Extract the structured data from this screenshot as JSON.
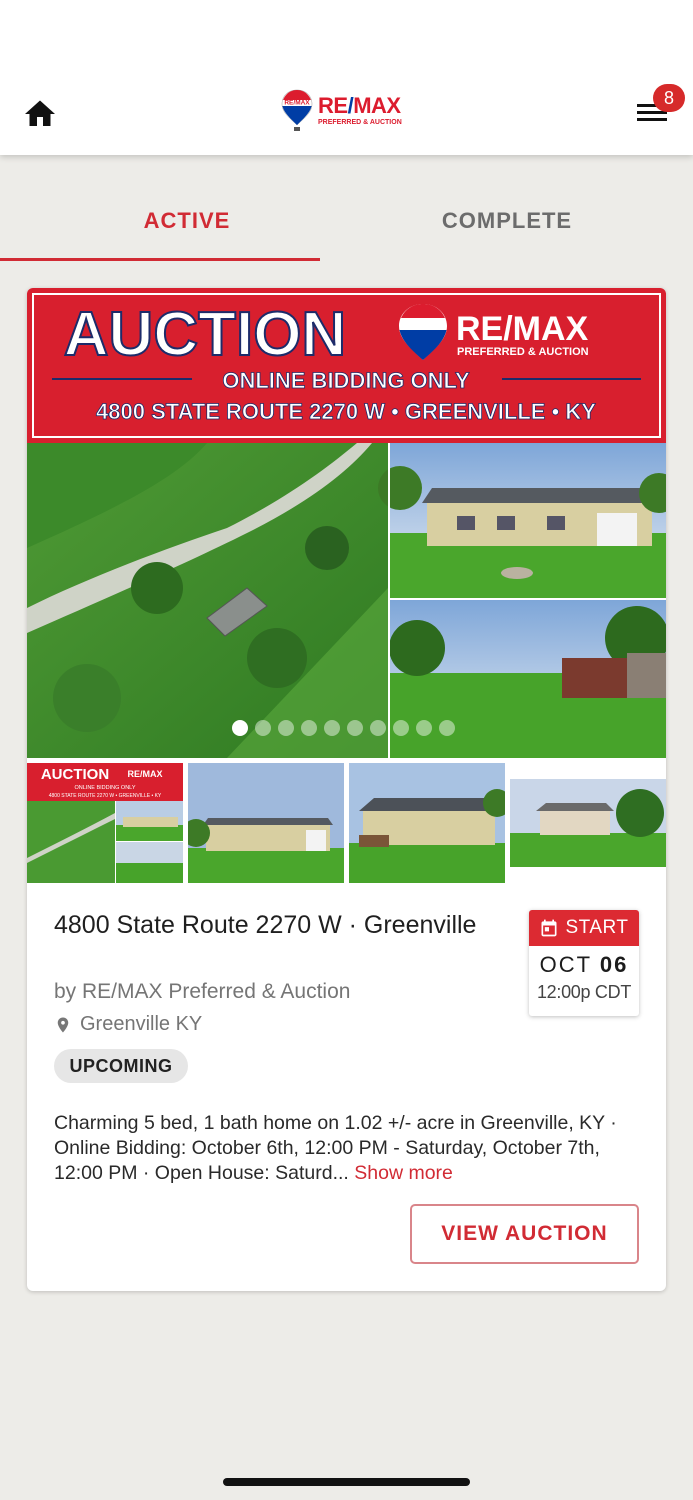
{
  "header": {
    "brand_main": "RE/MAX",
    "brand_sub": "PREFERRED & AUCTION",
    "balloon_text": "RE/MAX",
    "menu_badge": "8"
  },
  "tabs": [
    {
      "label": "ACTIVE",
      "selected": true
    },
    {
      "label": "COMPLETE",
      "selected": false
    }
  ],
  "listing": {
    "banner": {
      "headline": "AUCTION",
      "brand": "RE/MAX",
      "brand_sub": "PREFERRED & AUCTION",
      "line1": "ONLINE BIDDING ONLY",
      "line2": "4800 STATE ROUTE 2270 W • GREENVILLE • KY"
    },
    "carousel": {
      "count": 10,
      "active_index": 0
    },
    "thumb_banner": {
      "headline": "AUCTION",
      "brand": "RE/MAX",
      "line1": "ONLINE BIDDING ONLY",
      "line2": "4800 STATE ROUTE 2270 W • GREENVILLE • KY"
    },
    "title": "4800 State Route 2270 W · Greenville",
    "byline": "by RE/MAX Preferred & Auction",
    "location": "Greenville KY",
    "status": "UPCOMING",
    "date": {
      "label": "START",
      "month": "OCT",
      "day": "06",
      "time": "12:00p CDT"
    },
    "description": "Charming 5 bed, 1 bath home on 1.02 +/- acre in Greenville, KY · Online Bidding: October 6th, 12:00 PM - Saturday, October 7th, 12:00 PM · Open House: Saturd...",
    "show_more": "Show more",
    "cta": "VIEW AUCTION"
  },
  "colors": {
    "accent": "#d12b34",
    "banner_red": "#d81f2e",
    "remax_blue": "#003da5",
    "background": "#edece8"
  },
  "icons": [
    "home-icon",
    "hamburger-menu-icon",
    "calendar-icon",
    "location-pin-icon"
  ]
}
